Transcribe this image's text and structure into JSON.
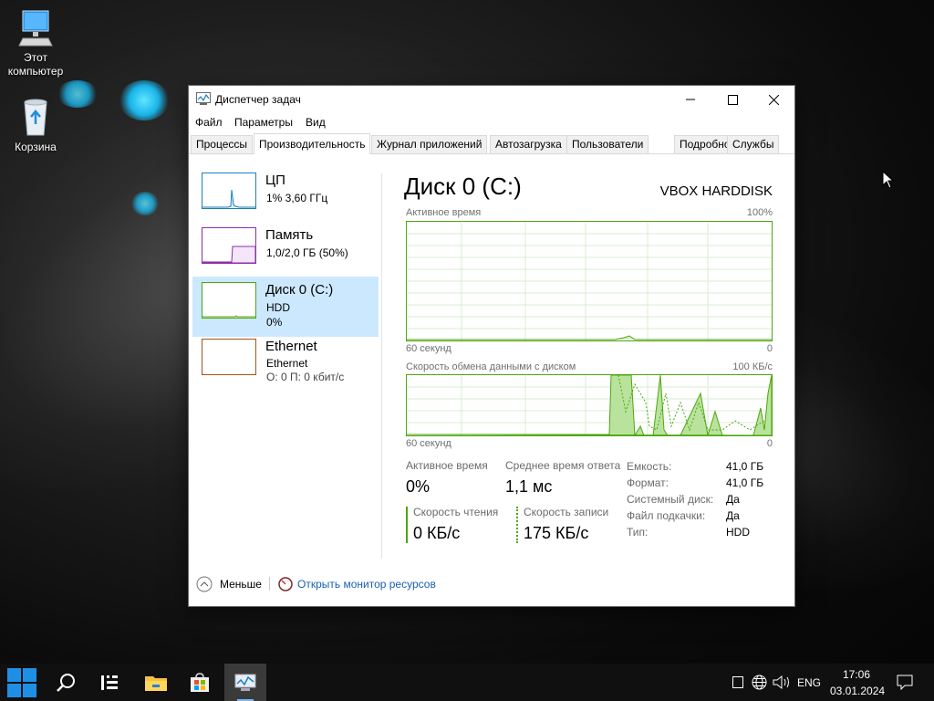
{
  "desktop": {
    "icons": [
      {
        "label": "Этот компьютер"
      },
      {
        "label": "Корзина"
      }
    ]
  },
  "window": {
    "title": "Диспетчер задач",
    "menu": [
      "Файл",
      "Параметры",
      "Вид"
    ],
    "tabs": [
      "Процессы",
      "Производительность",
      "Журнал приложений",
      "Автозагрузка",
      "Пользователи",
      "Подробности",
      "Службы"
    ],
    "active_tab": "Производительность"
  },
  "resources": [
    {
      "name": "ЦП",
      "line1": "1% 3,60 ГГц",
      "line2": "",
      "color": "#1a7fbf"
    },
    {
      "name": "Память",
      "line1": "1,0/2,0 ГБ (50%)",
      "line2": "",
      "color": "#8b2fa8"
    },
    {
      "name": "Диск 0 (C:)",
      "line1": "HDD",
      "line2": "0%",
      "color": "#4da60c"
    },
    {
      "name": "Ethernet",
      "line1": "Ethernet",
      "line2": "О: 0 П: 0 кбит/с",
      "color": "#a7531a"
    }
  ],
  "detail": {
    "heading": "Диск 0 (C:)",
    "model": "VBOX HARDDISK",
    "graph1": {
      "label": "Активное время",
      "max": "100%",
      "time": "60 секунд",
      "min": "0"
    },
    "graph2": {
      "label": "Скорость обмена данными с диском",
      "max": "100 КБ/с",
      "time": "60 секунд",
      "min": "0"
    },
    "stats": {
      "active_time_label": "Активное время",
      "active_time_value": "0%",
      "response_label": "Среднее время ответа",
      "response_value": "1,1 мс",
      "read_label": "Скорость чтения",
      "read_value": "0 КБ/с",
      "write_label": "Скорость записи",
      "write_value": "175 КБ/с"
    },
    "props": [
      {
        "key": "Емкость:",
        "value": "41,0 ГБ"
      },
      {
        "key": "Формат:",
        "value": "41,0 ГБ"
      },
      {
        "key": "Системный диск:",
        "value": "Да"
      },
      {
        "key": "Файл подкачки:",
        "value": "Да"
      },
      {
        "key": "Тип:",
        "value": "HDD"
      }
    ]
  },
  "footer": {
    "less_label": "Меньше",
    "monitor_link": "Открыть монитор ресурсов"
  },
  "taskbar": {
    "lang": "ENG",
    "time": "17:06",
    "date": "03.01.2024"
  },
  "colors": {
    "disk_green": "#4da60c",
    "selected_bg": "#cce8ff",
    "link_blue": "#1a5fb4"
  }
}
